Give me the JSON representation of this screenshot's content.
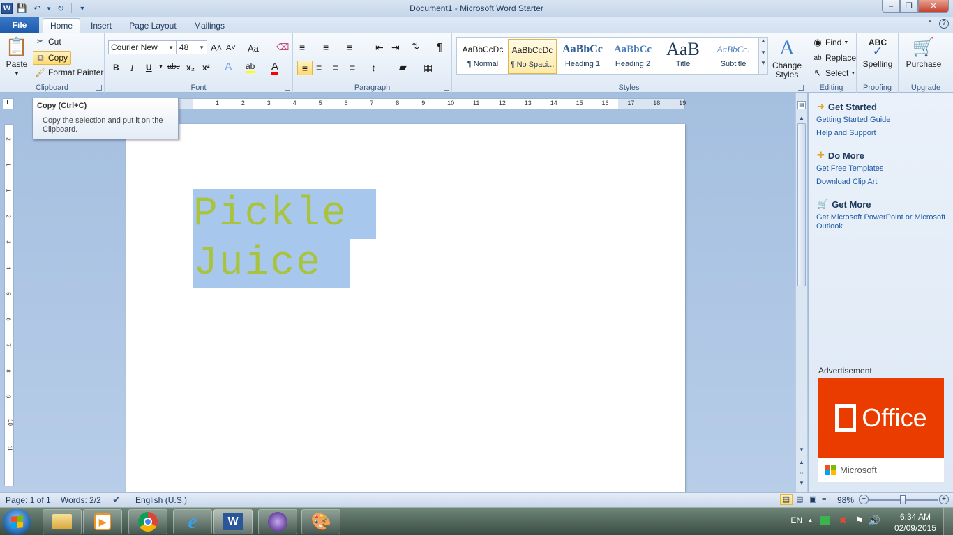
{
  "window": {
    "title": "Document1  -  Microsoft Word Starter",
    "app_icon": "W",
    "min_glyph": "–",
    "max_glyph": "❐",
    "close_glyph": "✕"
  },
  "tabs": {
    "file": "File",
    "items": [
      "Home",
      "Insert",
      "Page Layout",
      "Mailings"
    ],
    "active": "Home"
  },
  "clipboard": {
    "paste": "Paste",
    "cut": "Cut",
    "copy": "Copy",
    "format_painter": "Format Painter",
    "label": "Clipboard"
  },
  "font": {
    "name": "Courier New",
    "size": "48",
    "label": "Font",
    "bold": "B",
    "italic": "I",
    "underline": "U",
    "strike": "abc",
    "subscript": "x₂",
    "superscript": "x²",
    "grow": "A˄",
    "shrink": "A˅",
    "case": "Aa",
    "effects": "A",
    "highlight": "ab",
    "color": "A"
  },
  "paragraph": {
    "label": "Paragraph",
    "show_marks": "¶"
  },
  "styles": {
    "label": "Styles",
    "items": [
      {
        "sample": "AaBbCcDc",
        "name": "¶ Normal"
      },
      {
        "sample": "AaBbCcDc",
        "name": "¶ No Spaci..."
      },
      {
        "sample": "AaBbCc",
        "name": "Heading 1"
      },
      {
        "sample": "AaBbCc",
        "name": "Heading 2"
      },
      {
        "sample": "AaB",
        "name": "Title"
      },
      {
        "sample": "AaBbCc.",
        "name": "Subtitle"
      }
    ],
    "selected_index": 1,
    "change_styles_line1": "Change",
    "change_styles_line2": "Styles",
    "change_styles_icon": "A"
  },
  "editing": {
    "label": "Editing",
    "find": "Find",
    "replace": "Replace",
    "select": "Select"
  },
  "proofing": {
    "label": "Proofing",
    "spelling": "Spelling",
    "icon_text": "ABC"
  },
  "upgrade": {
    "label": "Upgrade",
    "purchase": "Purchase"
  },
  "tooltip": {
    "title": "Copy (Ctrl+C)",
    "body": "Copy the selection and put it on the Clipboard."
  },
  "ruler": {
    "corner": "L",
    "h_labels": [
      "1",
      "2",
      "3",
      "4",
      "5",
      "6",
      "7",
      "8",
      "9",
      "10",
      "11",
      "12",
      "13",
      "14",
      "15",
      "16",
      "17",
      "18",
      "19"
    ],
    "v_labels": [
      "2",
      "1",
      "1",
      "2",
      "3",
      "4",
      "5",
      "6",
      "7",
      "8",
      "9",
      "10",
      "11"
    ]
  },
  "document": {
    "lines": [
      "Pickle",
      "Juice"
    ],
    "text_color": "#a9c43c",
    "selection_color": "#a7c8ec"
  },
  "pane": {
    "get_started": {
      "title": "Get Started",
      "links": [
        "Getting Started Guide",
        "Help and Support"
      ]
    },
    "do_more": {
      "title": "Do More",
      "links": [
        "Get Free Templates",
        "Download Clip Art"
      ]
    },
    "get_more": {
      "title": "Get More",
      "links": [
        "Get Microsoft PowerPoint or Microsoft Outlook"
      ]
    },
    "ad_label": "Advertisement",
    "ad_office": "Office",
    "ad_microsoft": "Microsoft"
  },
  "statusbar": {
    "page": "Page: 1 of 1",
    "words": "Words: 2/2",
    "language": "English (U.S.)",
    "zoom": "98%",
    "zoom_level": 0.49
  },
  "taskbar": {
    "lang": "EN",
    "time": "6:34 AM",
    "date": "02/09/2015",
    "apps": [
      "explorer-icon",
      "media-player-icon",
      "chrome-icon",
      "ie-icon",
      "word-icon",
      "media-center-icon",
      "paint-icon"
    ]
  },
  "colors": {
    "file_tab": "#1f5bab",
    "office_orange": "#eb3c00",
    "link_blue": "#1f5ba6"
  }
}
